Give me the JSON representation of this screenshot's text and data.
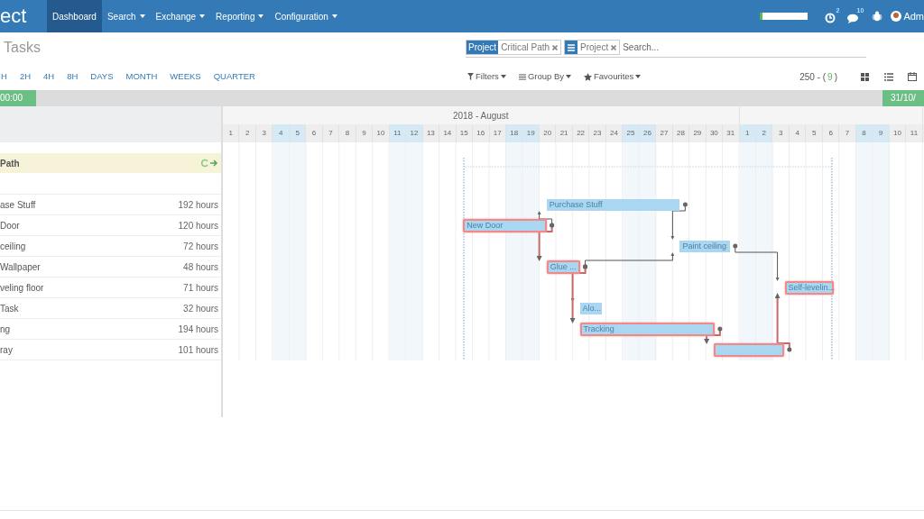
{
  "navbar": {
    "brand": "ect",
    "menu": [
      {
        "label": "Dashboard",
        "selected": true,
        "dropdown": false
      },
      {
        "label": "Search",
        "selected": false,
        "dropdown": true
      },
      {
        "label": "Exchange",
        "selected": false,
        "dropdown": true
      },
      {
        "label": "Reporting",
        "selected": false,
        "dropdown": true
      },
      {
        "label": "Configuration",
        "selected": false,
        "dropdown": true
      }
    ],
    "progress": {
      "level": 0.05
    },
    "activity_badge": "2",
    "messages_badge": "10",
    "user": "Adm"
  },
  "page_title": "Tasks",
  "search": {
    "facets": [
      {
        "kind": "label",
        "label": "Project",
        "value": "Critical Path"
      },
      {
        "kind": "icon",
        "value": "Project"
      }
    ],
    "placeholder": "Search..."
  },
  "scales": [
    "H",
    "2H",
    "4H",
    "8H",
    "DAYS",
    "MONTH",
    "WEEKS",
    "QUARTER"
  ],
  "filters": [
    "Filters",
    "Group By",
    "Favourites"
  ],
  "pager": {
    "total": "250 - (",
    "count": "9",
    "close": ")"
  },
  "timeline": {
    "start": "00:00",
    "end": "31/10/"
  },
  "gantt": {
    "month_label": "2018 - August",
    "days": [
      {
        "label": "1",
        "weekend": false
      },
      {
        "label": "2",
        "weekend": false
      },
      {
        "label": "3",
        "weekend": false
      },
      {
        "label": "4",
        "weekend": true
      },
      {
        "label": "5",
        "weekend": true
      },
      {
        "label": "6",
        "weekend": false
      },
      {
        "label": "7",
        "weekend": false
      },
      {
        "label": "8",
        "weekend": false
      },
      {
        "label": "9",
        "weekend": false
      },
      {
        "label": "10",
        "weekend": false
      },
      {
        "label": "11",
        "weekend": true
      },
      {
        "label": "12",
        "weekend": true
      },
      {
        "label": "13",
        "weekend": false
      },
      {
        "label": "14",
        "weekend": false
      },
      {
        "label": "15",
        "weekend": false
      },
      {
        "label": "16",
        "weekend": false
      },
      {
        "label": "17",
        "weekend": false
      },
      {
        "label": "18",
        "weekend": true
      },
      {
        "label": "19",
        "weekend": true
      },
      {
        "label": "20",
        "weekend": false
      },
      {
        "label": "21",
        "weekend": false
      },
      {
        "label": "22",
        "weekend": false
      },
      {
        "label": "23",
        "weekend": false
      },
      {
        "label": "24",
        "weekend": false
      },
      {
        "label": "25",
        "weekend": true
      },
      {
        "label": "26",
        "weekend": true
      },
      {
        "label": "27",
        "weekend": false
      },
      {
        "label": "28",
        "weekend": false
      },
      {
        "label": "29",
        "weekend": false
      },
      {
        "label": "30",
        "weekend": false
      },
      {
        "label": "31",
        "weekend": false
      },
      {
        "label": "1",
        "weekend": true
      },
      {
        "label": "2",
        "weekend": true
      },
      {
        "label": "3",
        "weekend": false
      },
      {
        "label": "4",
        "weekend": false
      },
      {
        "label": "5",
        "weekend": false
      },
      {
        "label": "6",
        "weekend": false
      },
      {
        "label": "7",
        "weekend": false
      },
      {
        "label": "8",
        "weekend": true
      },
      {
        "label": "9",
        "weekend": true
      },
      {
        "label": "10",
        "weekend": false
      },
      {
        "label": "11",
        "weekend": false
      }
    ],
    "group": {
      "name": "Path"
    },
    "tasks": [
      {
        "name": "ase Stuff",
        "duration": "192 hours",
        "bar_label": "Purchase Stuff",
        "critical": false
      },
      {
        "name": "Door",
        "duration": "120 hours",
        "bar_label": "New Door",
        "critical": true
      },
      {
        "name": "ceiling",
        "duration": "72 hours",
        "bar_label": "Paint ceiling",
        "critical": false
      },
      {
        "name": "Wallpaper",
        "duration": "48 hours",
        "bar_label": "Glue ...",
        "critical": true
      },
      {
        "name": "veling floor",
        "duration": "71 hours",
        "bar_label": "Self-levelin...",
        "critical": true
      },
      {
        "name": "Task",
        "duration": "32 hours",
        "bar_label": "Alo...",
        "critical": false
      },
      {
        "name": "ng",
        "duration": "194 hours",
        "bar_label": "Tracking",
        "critical": true
      },
      {
        "name": "ray",
        "duration": "101 hours",
        "critical": true
      }
    ]
  }
}
